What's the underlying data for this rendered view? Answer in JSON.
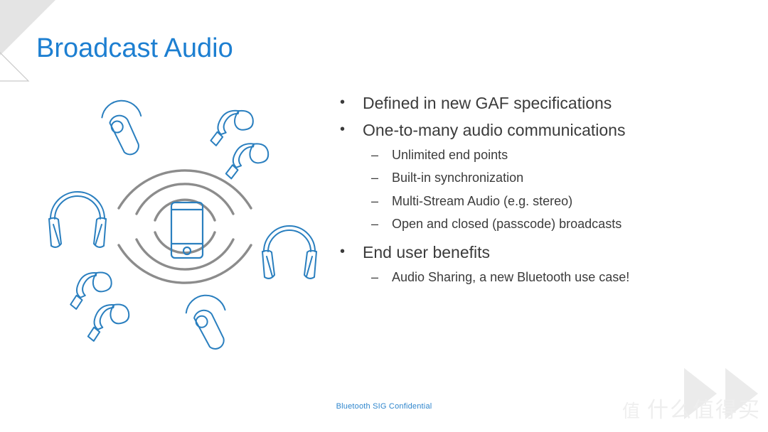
{
  "slide": {
    "title": "Broadcast Audio",
    "footer": "Bluetooth SIG Confidential",
    "watermark_badge": "值",
    "watermark_text": "什么值得买"
  },
  "colors": {
    "title_blue": "#1d7fd1",
    "body_gray": "#3b3b3b",
    "footer_blue": "#2f86cd",
    "icon_blue": "#2a7fbf",
    "wave_gray": "#8c8c8c",
    "corner_gray": "#e4e4e4"
  },
  "content": {
    "bullets": [
      {
        "marker": "•",
        "text": "Defined in new GAF specifications",
        "sub": []
      },
      {
        "marker": "•",
        "text": "One-to-many audio communications",
        "sub": [
          {
            "marker": "–",
            "text": "Unlimited end points"
          },
          {
            "marker": "–",
            "text": "Built-in synchronization"
          },
          {
            "marker": "–",
            "text": "Multi-Stream Audio (e.g. stereo)"
          },
          {
            "marker": "–",
            "text": "Open and closed (passcode) broadcasts"
          }
        ]
      },
      {
        "marker": "•",
        "text": "End user benefits",
        "sub": [
          {
            "marker": "–",
            "text": "Audio Sharing, a new Bluetooth use case!"
          }
        ]
      }
    ]
  },
  "illustration": {
    "center_device": "smartphone",
    "wave_rings": 3,
    "devices": [
      {
        "name": "earbud-hook-top-left",
        "type": "hook-earbud"
      },
      {
        "name": "earbud-pair-top-right",
        "type": "earbud-pair"
      },
      {
        "name": "headphones-left",
        "type": "headphones"
      },
      {
        "name": "headphones-right",
        "type": "headphones"
      },
      {
        "name": "earbud-pair-bottom-left",
        "type": "earbud-pair"
      },
      {
        "name": "earbud-hook-bottom",
        "type": "hook-earbud"
      }
    ]
  }
}
